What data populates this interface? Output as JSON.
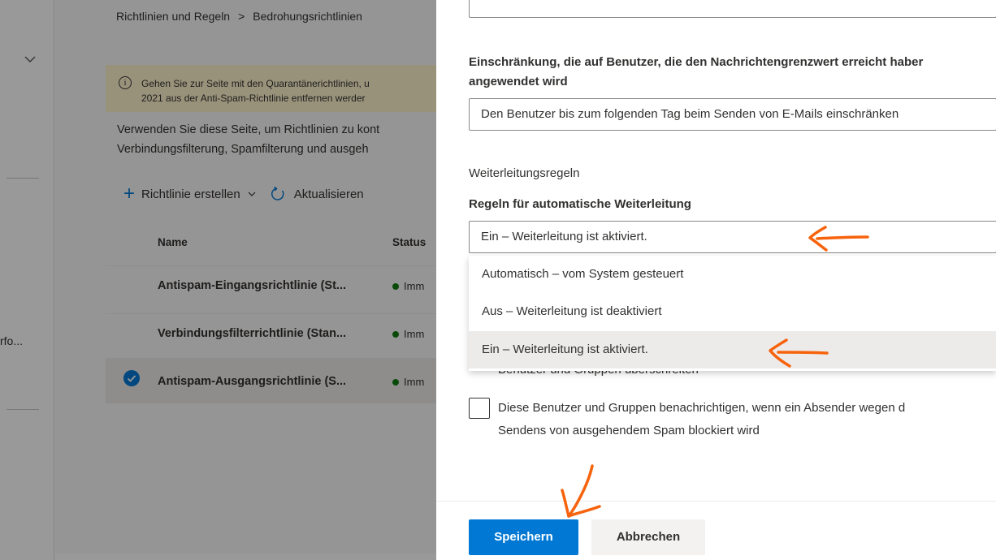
{
  "background_page": {
    "breadcrumb": [
      "Richtlinien und Regeln",
      "Bedrohungsrichtlinien"
    ],
    "breadcrumb_separator": ">",
    "left_nav_truncated": "rfo...",
    "banner": {
      "line1": "Gehen Sie zur Seite mit den Quarantänerichtlinien, u",
      "line2": "2021 aus der Anti-Spam-Richtlinie entfernen werder"
    },
    "description": {
      "line1": "Verwenden Sie diese Seite, um Richtlinien zu kont",
      "line2": "Verbindungsfilterung, Spamfilterung und ausgeh"
    },
    "toolbar": {
      "create_label": "Richtlinie erstellen",
      "refresh_label": "Aktualisieren"
    },
    "table": {
      "columns": [
        "Name",
        "Status"
      ],
      "rows": [
        {
          "name": "Antispam-Eingangsrichtlinie (St...",
          "status": "Imm",
          "selected": false
        },
        {
          "name": "Verbindungsfilterrichtlinie (Stan...",
          "status": "Imm",
          "selected": false
        },
        {
          "name": "Antispam-Ausgangsrichtlinie (S...",
          "status": "Imm",
          "selected": true
        }
      ]
    }
  },
  "panel": {
    "restriction": {
      "label_line1": "Einschränkung, die auf Benutzer, die den Nachrichtengrenzwert erreicht haber",
      "label_line2": "angewendet wird",
      "value": "Den Benutzer bis zum folgenden Tag beim Senden von E-Mails einschränken"
    },
    "forwarding": {
      "section_title": "Weiterleitungsregeln",
      "field_label": "Regeln für automatische Weiterleitung",
      "selected_value": "Ein – Weiterleitung ist aktiviert.",
      "options": [
        "Automatisch – vom System gesteuert",
        "Aus – Weiterleitung ist deaktiviert",
        "Ein – Weiterleitung ist aktiviert."
      ],
      "hovered_option_index": 2
    },
    "obscured_text": "Benutzer und Gruppen überschreiten",
    "notify_checkbox": {
      "checked": false,
      "label_line1": "Diese Benutzer und Gruppen benachrichtigen, wenn ein Absender wegen d",
      "label_line2": "Sendens von ausgehendem Spam blockiert wird"
    },
    "buttons": {
      "save": "Speichern",
      "cancel": "Abbrechen"
    }
  },
  "colors": {
    "accent": "#0078d4",
    "annotation": "#f7630c",
    "status_ok": "#107c10",
    "banner_bg": "#fff4ce"
  }
}
